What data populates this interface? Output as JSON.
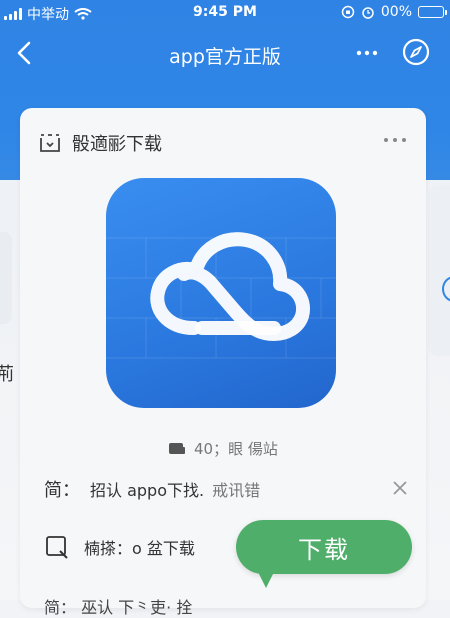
{
  "status_bar": {
    "carrier": "中举动",
    "time": "9:45 PM",
    "battery": "00%"
  },
  "nav": {
    "title": "app官方正版",
    "more_icon": "more-dots-icon",
    "compass_icon": "compass-icon",
    "back_icon": "chevron-left-icon"
  },
  "card": {
    "title": "骰適彨下载",
    "more_icon": "more-dots-icon",
    "app_icon": "cloud-logo",
    "meta": "40；眼 偒站",
    "row1": {
      "prefix": "简：",
      "text": "招认 appo下找.",
      "sub": "戒讯错"
    },
    "row2": {
      "text": "楠搽：o 盆下载"
    },
    "row3": {
      "text": "简：  巫认 下⺀吏· 拴"
    }
  },
  "download_bubble": {
    "label": "下载"
  },
  "side": {
    "left_text": "荊"
  },
  "colors": {
    "primary_blue": "#2f86e6",
    "download_green": "#4fae6a"
  }
}
